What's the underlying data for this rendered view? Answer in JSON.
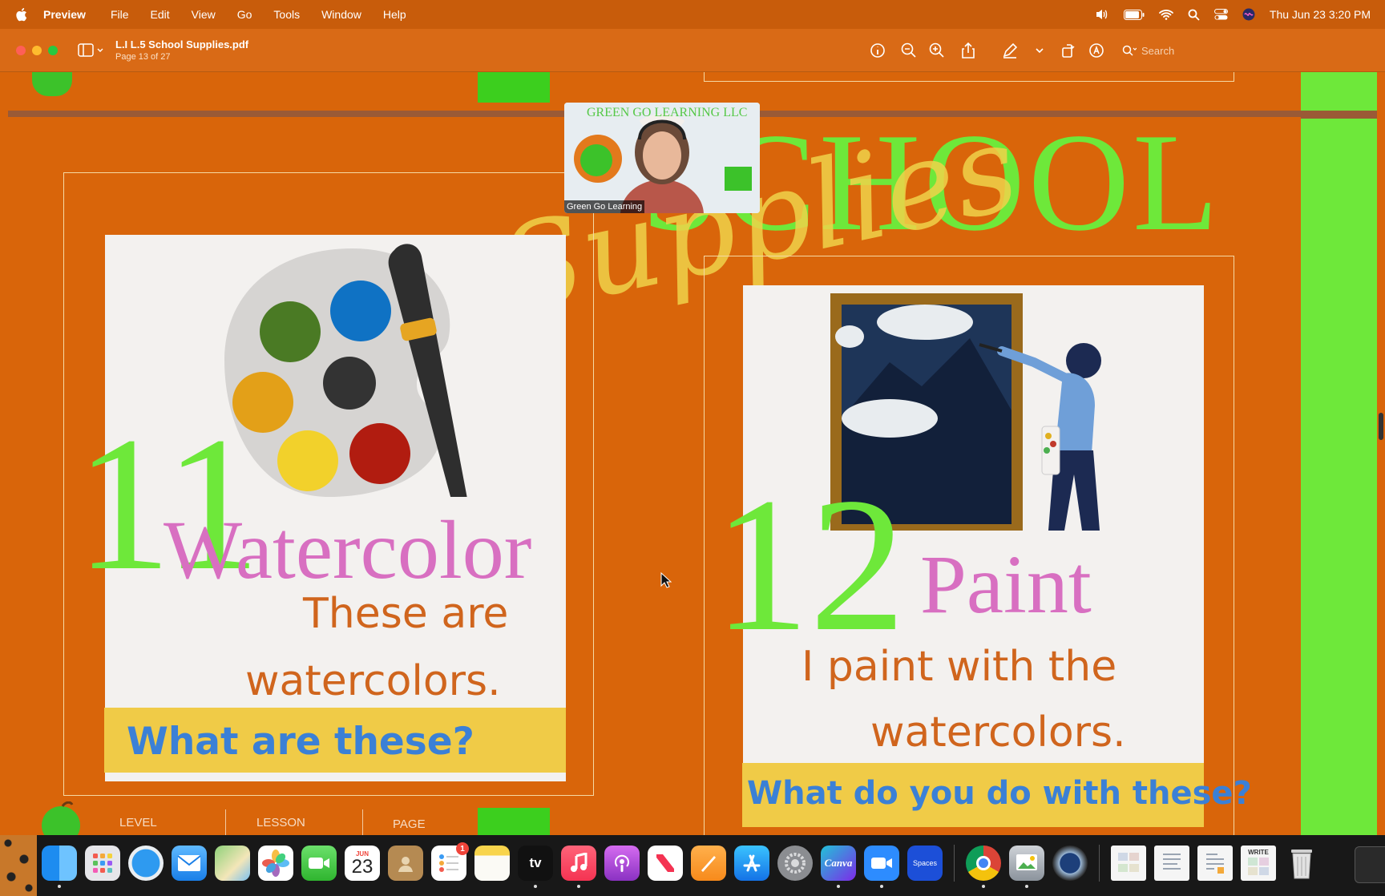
{
  "menubar": {
    "app_name": "Preview",
    "items": [
      "File",
      "Edit",
      "View",
      "Go",
      "Tools",
      "Window",
      "Help"
    ],
    "clock": "Thu Jun 23  3:20 PM"
  },
  "toolbar": {
    "title": "L.I L.5 School Supplies.pdf",
    "page_info": "Page 13 of 27",
    "search_placeholder": "Search"
  },
  "document": {
    "heading": "SCHOOL",
    "heading_script": "Supplies",
    "cards": [
      {
        "number": "11",
        "word": "Watercolor",
        "sentence_line1": "These are",
        "sentence_line2": "watercolors.",
        "question": "What are these?"
      },
      {
        "number": "12",
        "word": "Paint",
        "sentence_line1": "I paint with the",
        "sentence_line2": "watercolors.",
        "question": "What do you do with these?"
      }
    ],
    "footer": {
      "level": "LEVEL",
      "lesson": "LESSON",
      "page": "PAGE"
    },
    "palette_colors": [
      "#4a7a24",
      "#0f72c4",
      "#e3a018",
      "#333333",
      "#f2d12b",
      "#b11c10"
    ]
  },
  "video_overlay": {
    "participant_name": "Green Go Learning",
    "banner_text": "GREEN GO LEARNING LLC"
  },
  "dock": {
    "calendar_month": "JUN",
    "calendar_day": "23",
    "reminders_badge": "1",
    "canva_label": "Canva",
    "spaces_label": "Spaces",
    "tv_label": "tv",
    "write_label": "WRITE"
  }
}
